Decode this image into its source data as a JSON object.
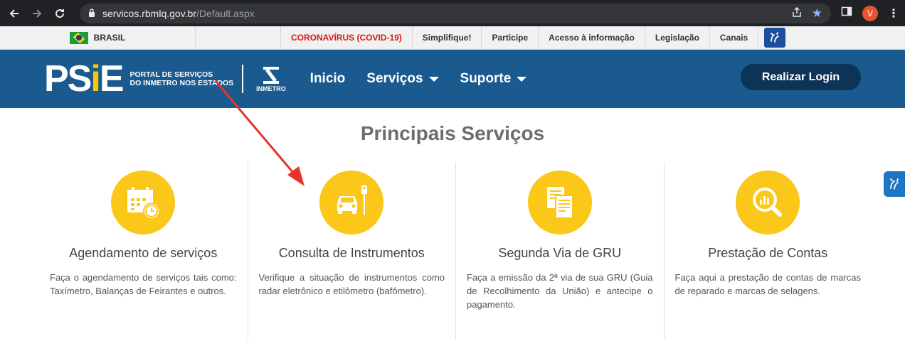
{
  "browser": {
    "url_host": "servicos.rbmlq.gov.br",
    "url_path": "/Default.aspx",
    "profile_initial": "V"
  },
  "govbar": {
    "brasil": "BRASIL",
    "links": [
      "CORONAVÍRUS (COVID-19)",
      "Simplifique!",
      "Participe",
      "Acesso à informação",
      "Legislação",
      "Canais"
    ]
  },
  "header": {
    "logo_text_p": "PS",
    "logo_text_i": "i",
    "logo_text_e": "E",
    "logo_subtitle_1": "PORTAL DE SERVIÇOS",
    "logo_subtitle_2": "DO INMETRO NOS ESTADOS",
    "inmetro_label": "INMETRO",
    "nav": [
      "Inicio",
      "Serviços",
      "Suporte"
    ],
    "login": "Realizar Login"
  },
  "main": {
    "title": "Principais Serviços",
    "cards": [
      {
        "title": "Agendamento de serviços",
        "desc": "Faça o agendamento de serviços tais como: Taxímetro, Balanças de Feirantes e outros.",
        "icon": "calendar-clock-icon"
      },
      {
        "title": "Consulta de Instrumentos",
        "desc": "Verifique a situação de instrumentos como radar eletrônico e etilômetro (bafômetro).",
        "icon": "car-radar-icon"
      },
      {
        "title": "Segunda Via de GRU",
        "desc": "Faça a emissão da 2ª via de sua GRU (Guia de Recolhimento da União) e antecipe o pagamento.",
        "icon": "documents-icon"
      },
      {
        "title": "Prestação de Contas",
        "desc": "Faça aqui a prestação de contas de marcas de reparado e marcas de selagens.",
        "icon": "magnifier-chart-icon"
      }
    ]
  },
  "colors": {
    "header_bg": "#1a5a8e",
    "accent_yellow": "#fbc719",
    "login_bg": "#0d3357",
    "annotation_arrow": "#e8322a"
  }
}
